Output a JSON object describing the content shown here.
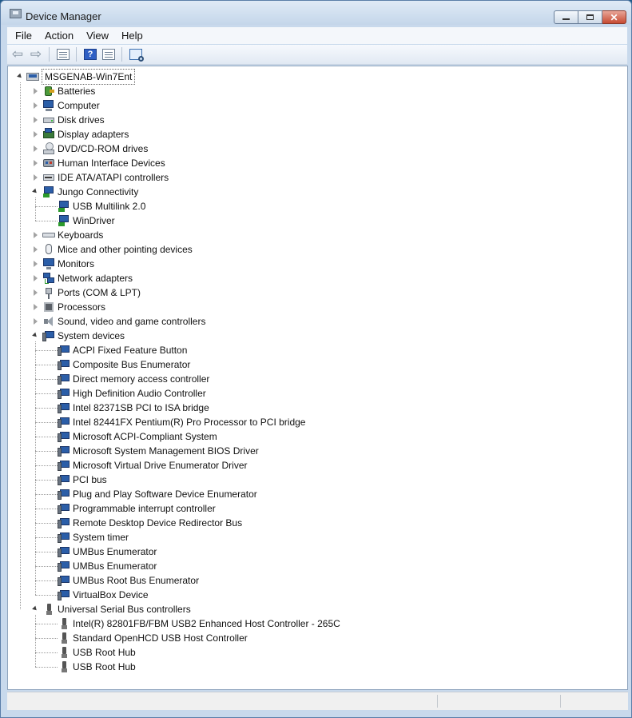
{
  "window": {
    "title": "Device Manager"
  },
  "menu": [
    "File",
    "Action",
    "View",
    "Help"
  ],
  "toolbar_icons": [
    "back-arrow-icon",
    "forward-arrow-icon",
    "show-hide-tree-icon",
    "help-icon",
    "properties-icon",
    "scan-hardware-icon"
  ],
  "tree": {
    "root": "MSGENAB-Win7Ent",
    "categories": [
      {
        "label": "Batteries",
        "icon": "battery",
        "expanded": false
      },
      {
        "label": "Computer",
        "icon": "pc",
        "expanded": false
      },
      {
        "label": "Disk drives",
        "icon": "disk",
        "expanded": false
      },
      {
        "label": "Display adapters",
        "icon": "display",
        "expanded": false
      },
      {
        "label": "DVD/CD-ROM drives",
        "icon": "dvd",
        "expanded": false
      },
      {
        "label": "Human Interface Devices",
        "icon": "hid",
        "expanded": false
      },
      {
        "label": "IDE ATA/ATAPI controllers",
        "icon": "ide",
        "expanded": false
      },
      {
        "label": "Jungo Connectivity",
        "icon": "jungo",
        "expanded": true,
        "children": [
          "USB Multilink 2.0",
          "WinDriver"
        ]
      },
      {
        "label": "Keyboards",
        "icon": "kbd",
        "expanded": false
      },
      {
        "label": "Mice and other pointing devices",
        "icon": "mouse",
        "expanded": false
      },
      {
        "label": "Monitors",
        "icon": "monitor",
        "expanded": false
      },
      {
        "label": "Network adapters",
        "icon": "net",
        "expanded": false
      },
      {
        "label": "Ports (COM & LPT)",
        "icon": "ports",
        "expanded": false
      },
      {
        "label": "Processors",
        "icon": "cpu",
        "expanded": false
      },
      {
        "label": "Sound, video and game controllers",
        "icon": "sound",
        "expanded": false
      },
      {
        "label": "System devices",
        "icon": "sysdev",
        "expanded": true,
        "children": [
          "ACPI Fixed Feature Button",
          "Composite Bus Enumerator",
          "Direct memory access controller",
          "High Definition Audio Controller",
          "Intel 82371SB PCI to ISA bridge",
          "Intel 82441FX Pentium(R) Pro Processor to PCI bridge",
          "Microsoft ACPI-Compliant System",
          "Microsoft System Management BIOS Driver",
          "Microsoft Virtual Drive Enumerator Driver",
          "PCI bus",
          "Plug and Play Software Device Enumerator",
          "Programmable interrupt controller",
          "Remote Desktop Device Redirector Bus",
          "System timer",
          "UMBus Enumerator",
          "UMBus Enumerator",
          "UMBus Root Bus Enumerator",
          "VirtualBox Device"
        ]
      },
      {
        "label": "Universal Serial Bus controllers",
        "icon": "usb",
        "expanded": true,
        "children": [
          "Intel(R) 82801FB/FBM USB2 Enhanced Host Controller - 265C",
          "Standard OpenHCD USB Host Controller",
          "USB Root Hub",
          "USB Root Hub"
        ]
      }
    ]
  }
}
